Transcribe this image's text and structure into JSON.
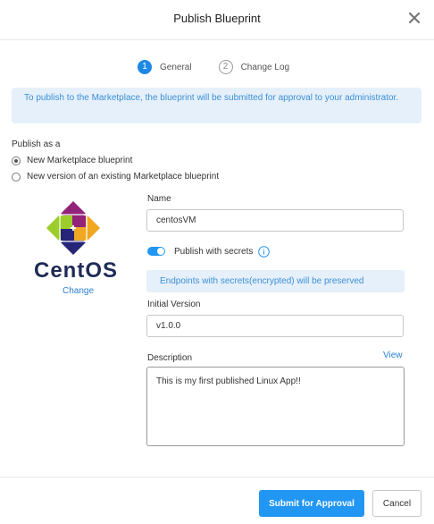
{
  "dialog": {
    "title": "Publish Blueprint"
  },
  "steps": [
    {
      "number": "1",
      "label": "General"
    },
    {
      "number": "2",
      "label": "Change Log"
    }
  ],
  "info_banner": "To publish to the Marketplace, the blueprint will be submitted for approval to your administrator.",
  "publish_as": {
    "label": "Publish as a",
    "options": [
      {
        "label": "New Marketplace blueprint",
        "checked": true
      },
      {
        "label": "New version of an existing Marketplace blueprint",
        "checked": false
      }
    ]
  },
  "logo": {
    "text": "CentOS",
    "change_label": "Change"
  },
  "form": {
    "name_label": "Name",
    "name_value": "centosVM",
    "secrets_toggle_label": "Publish with secrets",
    "secrets_toggle_on": true,
    "secrets_note": "Endpoints with secrets(encrypted) will be preserved",
    "version_label": "Initial Version",
    "version_value": "v1.0.0",
    "description_label": "Description",
    "view_label": "View",
    "description_value": "This is my first published Linux App!!"
  },
  "footer": {
    "submit_label": "Submit for Approval",
    "cancel_label": "Cancel"
  },
  "colors": {
    "accent": "#2196f3",
    "info_bg": "#e6f0fa",
    "info_text": "#3a8fd6",
    "logo_text": "#1f2b56"
  }
}
